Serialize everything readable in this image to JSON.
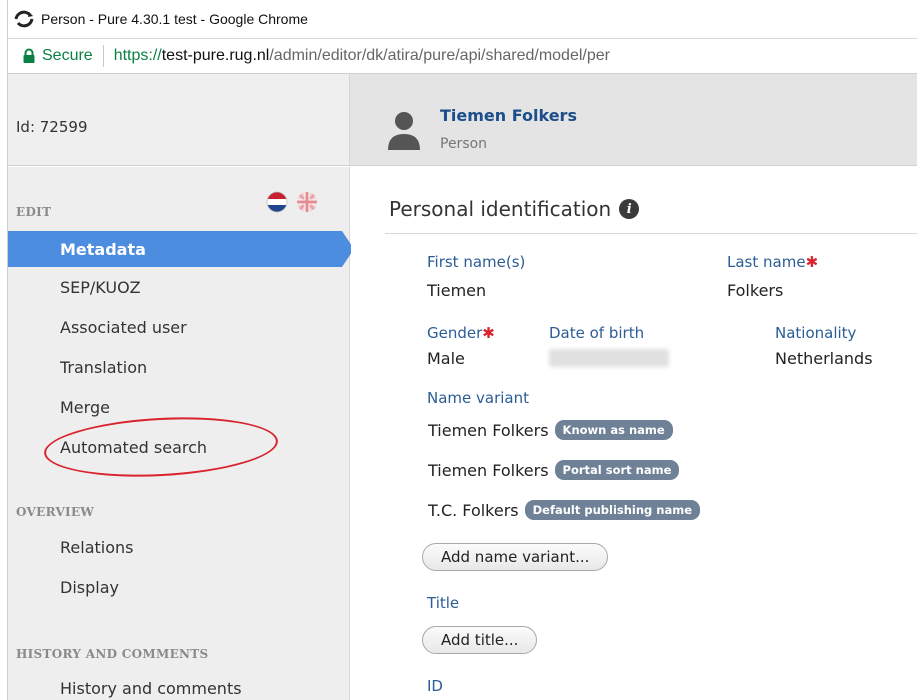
{
  "browser": {
    "window_title": "Person - Pure 4.30.1 test - Google Chrome",
    "secure_label": "Secure",
    "url_scheme": "https://",
    "url_host": "test-pure.rug.nl",
    "url_path": "/admin/editor/dk/atira/pure/api/shared/model/per"
  },
  "header": {
    "id_label": "Id: 72599",
    "person_name": "Tiemen Folkers",
    "person_type": "Person"
  },
  "sidebar": {
    "edit_title": "EDIT",
    "edit_items": [
      {
        "label": "Metadata",
        "active": true
      },
      {
        "label": "SEP/KUOZ"
      },
      {
        "label": "Associated user"
      },
      {
        "label": "Translation"
      },
      {
        "label": "Merge"
      },
      {
        "label": "Automated search"
      }
    ],
    "overview_title": "OVERVIEW",
    "overview_items": [
      {
        "label": "Relations"
      },
      {
        "label": "Display"
      }
    ],
    "history_title": "HISTORY AND COMMENTS",
    "history_items": [
      {
        "label": "History and comments"
      }
    ]
  },
  "main": {
    "section_title": "Personal identification",
    "first_name_label": "First name(s)",
    "first_name_value": "Tiemen",
    "last_name_label": "Last name",
    "last_name_value": "Folkers",
    "gender_label": "Gender",
    "gender_value": "Male",
    "dob_label": "Date of birth",
    "nationality_label": "Nationality",
    "nationality_value": "Netherlands",
    "name_variant_label": "Name variant",
    "variants": [
      {
        "name": "Tiemen Folkers",
        "badge": "Known as name"
      },
      {
        "name": "Tiemen Folkers",
        "badge": "Portal sort name"
      },
      {
        "name": "T.C. Folkers",
        "badge": "Default publishing name"
      }
    ],
    "add_variant_button": "Add name variant...",
    "title_label": "Title",
    "add_title_button": "Add title...",
    "id_label": "ID"
  },
  "colors": {
    "active_nav": "#4d8de0",
    "label_blue": "#2b5d96",
    "required_red": "#d9232d",
    "badge_bg": "#6f8196",
    "secure_green": "#0b8043"
  }
}
